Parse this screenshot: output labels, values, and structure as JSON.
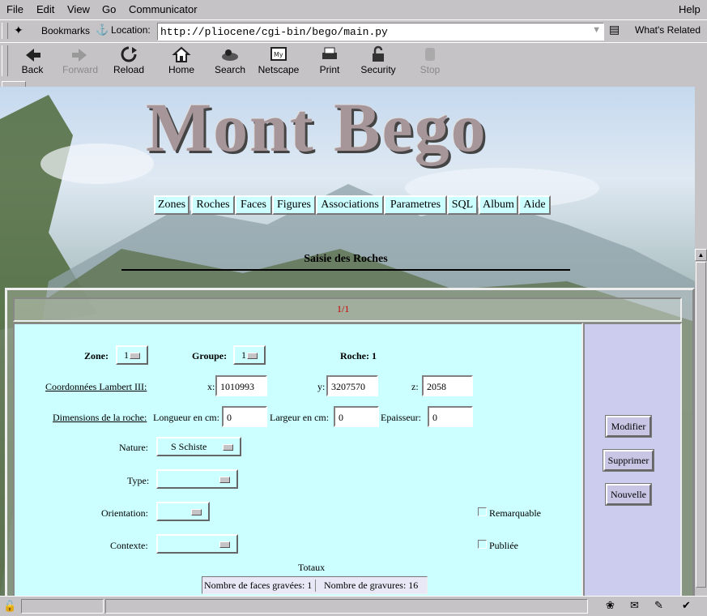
{
  "menu": {
    "file": "File",
    "edit": "Edit",
    "view": "View",
    "go": "Go",
    "communicator": "Communicator",
    "help": "Help"
  },
  "location": {
    "bookmarks_label": "Bookmarks",
    "location_label": "Location:",
    "url": "http://pliocene/cgi-bin/bego/main.py",
    "whats_related": "What's Related"
  },
  "toolbar": {
    "back": "Back",
    "forward": "Forward",
    "reload": "Reload",
    "home": "Home",
    "search": "Search",
    "netscape": "Netscape",
    "print": "Print",
    "security": "Security",
    "stop": "Stop"
  },
  "page": {
    "logo_text": "Mont Bego",
    "nav": [
      "Zones",
      "Roches",
      "Faces",
      "Figures",
      "Associations",
      "Parametres",
      "SQL",
      "Album",
      "Aide"
    ],
    "heading": "Saisie des Roches",
    "pager": "1/1"
  },
  "form": {
    "zone_label": "Zone:",
    "zone_value": "1",
    "groupe_label": "Groupe:",
    "groupe_value": "1",
    "roche_label": "Roche: 1",
    "coords_label": "Coordonnées Lambert III:",
    "x_label": "x:",
    "x_value": "1010993",
    "y_label": "y:",
    "y_value": "3207570",
    "z_label": "z:",
    "z_value": "2058",
    "dims_label": "Dimensions de la roche:",
    "longueur_label": "Longueur en cm:",
    "longueur_value": "0",
    "largeur_label": "Largeur en cm:",
    "largeur_value": "0",
    "epaisseur_label": "Epaisseur:",
    "epaisseur_value": "0",
    "nature_label": "Nature:",
    "nature_value": "S Schiste",
    "type_label": "Type:",
    "type_value": "",
    "orientation_label": "Orientation:",
    "orientation_value": "",
    "contexte_label": "Contexte:",
    "contexte_value": "",
    "remarquable_label": "Remarquable",
    "publiee_label": "Publiée",
    "totaux_label": "Totaux",
    "faces_total": "Nombre de faces gravées: 1",
    "gravures_total": "Nombre de gravures: 16"
  },
  "actions": {
    "modifier": "Modifier",
    "supprimer": "Supprimer",
    "nouvelle": "Nouvelle"
  },
  "colors": {
    "form_bg": "#ccffff",
    "side_bg": "#ccccee",
    "pager": "#cc0000"
  }
}
